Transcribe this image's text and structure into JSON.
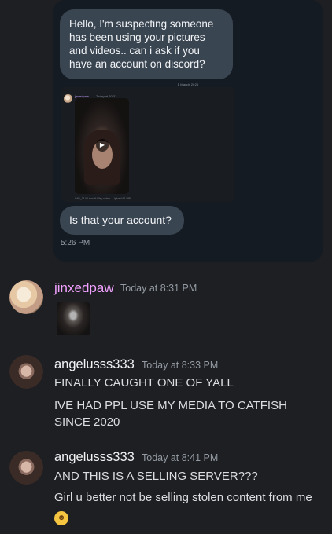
{
  "embed": {
    "bubble_top": "Hello, I'm suspecting someone has been using your pictures and videos.. can i ask if you have an account on discord?",
    "tiny_date": "1 March 2026",
    "inner_user": "jinxedpaw",
    "inner_time": "Today at 20:31",
    "inner_caption": "IMG_3148.mov** Play video - Upload 61 MB",
    "bubble_bottom": "Is that your account?",
    "time": "5:26 PM"
  },
  "messages": [
    {
      "username": "jinxedpaw",
      "timestamp": "Today at 8:31 PM",
      "lines": []
    },
    {
      "username": "angelusss333",
      "timestamp": "Today at 8:33 PM",
      "lines": [
        "FINALLY CAUGHT ONE OF YALL",
        "IVE HAD PPL USE MY MEDIA TO CATFISH SINCE 2020"
      ]
    },
    {
      "username": "angelusss333",
      "timestamp": "Today at 8:41 PM",
      "lines": [
        "AND THIS IS A SELLING SERVER???",
        "Girl u better not be selling stolen content from me"
      ]
    }
  ],
  "icons": {
    "play": "play-icon",
    "emoji": "loudly-crying-face-emoji"
  },
  "colors": {
    "background": "#1e1f22",
    "username_jinx": "#f0a1ff",
    "timestamp": "#949ba4",
    "bubble": "#3a4552"
  }
}
